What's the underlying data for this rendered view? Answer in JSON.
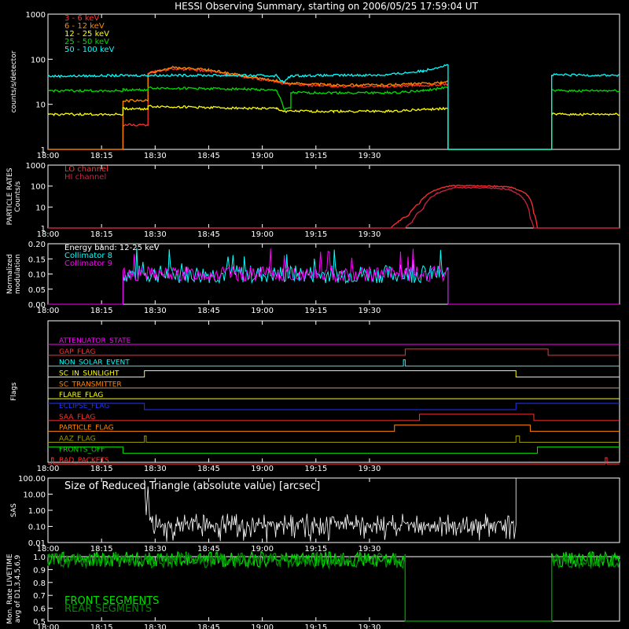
{
  "title": "HESSI Observing Summary, starting on 2006/05/25 17:59:04 UT",
  "time_ticks": [
    "18:00",
    "18:15",
    "18:30",
    "18:45",
    "19:00",
    "19:15",
    "19:30"
  ],
  "colors": {
    "axes": "#ffffff",
    "red": "#ff3030",
    "orange": "#ff8800",
    "yellow": "#ffff00",
    "green": "#00dd00",
    "cyan": "#00ffff",
    "magenta": "#ff00ff",
    "blue": "#2233ff",
    "olive": "#9a9a00",
    "white": "#ffffff"
  },
  "chart_data": [
    {
      "type": "line",
      "name": "count-rates",
      "ylabel": "counts/s/detector",
      "yscale": "log",
      "ylim": [
        1,
        1000
      ],
      "ytick_labels": [
        "1",
        "10",
        "100",
        "1000"
      ],
      "legend": [
        "3 - 6 keV",
        "6 - 12 keV",
        "12 - 25 keV",
        "25 - 50 keV",
        "50 - 100 keV"
      ],
      "series": [
        {
          "name": "3 - 6 keV",
          "color": "#ff3030",
          "points": [
            [
              0,
              1
            ],
            [
              21,
              1
            ],
            [
              21,
              3.5
            ],
            [
              28,
              3.5
            ],
            [
              28,
              50
            ],
            [
              35,
              62
            ],
            [
              45,
              55
            ],
            [
              55,
              40
            ],
            [
              64,
              32
            ],
            [
              66,
              28
            ],
            [
              80,
              25
            ],
            [
              95,
              25
            ],
            [
              110,
              27
            ],
            [
              112,
              28
            ]
          ]
        },
        {
          "name": "6 - 12 keV",
          "color": "#ff8800",
          "points": [
            [
              0,
              1
            ],
            [
              21,
              1
            ],
            [
              21,
              12
            ],
            [
              28,
              12
            ],
            [
              28,
              48
            ],
            [
              35,
              65
            ],
            [
              45,
              58
            ],
            [
              55,
              42
            ],
            [
              64,
              33
            ],
            [
              66,
              30
            ],
            [
              80,
              27
            ],
            [
              95,
              27
            ],
            [
              110,
              30
            ],
            [
              112,
              32
            ]
          ]
        },
        {
          "name": "12 - 25 keV",
          "color": "#ffff00",
          "points": [
            [
              0,
              6
            ],
            [
              21,
              6
            ],
            [
              21,
              8
            ],
            [
              28,
              8
            ],
            [
              28,
              9
            ],
            [
              64,
              8
            ],
            [
              66,
              7
            ],
            [
              80,
              7
            ],
            [
              95,
              7
            ],
            [
              110,
              8
            ],
            [
              112,
              8
            ],
            [
              112,
              1
            ],
            [
              141,
              1
            ],
            [
              141,
              6
            ],
            [
              160,
              6
            ]
          ]
        },
        {
          "name": "25 - 50 keV",
          "color": "#00dd00",
          "points": [
            [
              0,
              20
            ],
            [
              21,
              20
            ],
            [
              21,
              21
            ],
            [
              28,
              21
            ],
            [
              28,
              23
            ],
            [
              55,
              22
            ],
            [
              64,
              20
            ],
            [
              66,
              8
            ],
            [
              68,
              8
            ],
            [
              68,
              18
            ],
            [
              95,
              18
            ],
            [
              105,
              20
            ],
            [
              112,
              24
            ],
            [
              112,
              1
            ],
            [
              141,
              1
            ],
            [
              141,
              20
            ],
            [
              160,
              20
            ]
          ]
        },
        {
          "name": "50 - 100 keV",
          "color": "#00ffff",
          "points": [
            [
              0,
              42
            ],
            [
              28,
              44
            ],
            [
              50,
              44
            ],
            [
              64,
              43
            ],
            [
              66,
              30
            ],
            [
              68,
              43
            ],
            [
              95,
              45
            ],
            [
              105,
              55
            ],
            [
              112,
              75
            ],
            [
              112,
              1
            ],
            [
              141,
              1
            ],
            [
              141,
              45
            ],
            [
              160,
              44
            ]
          ]
        }
      ]
    },
    {
      "type": "line",
      "name": "particle-rates",
      "ylabel": "PARTICLE RATES\nCounts/s",
      "yscale": "log",
      "ylim": [
        1,
        1000
      ],
      "ytick_labels": [
        "1",
        "10",
        "100",
        "1000"
      ],
      "legend": [
        "LO channel",
        "HI channel"
      ],
      "series": [
        {
          "name": "LO channel",
          "color": "#ff3030",
          "points": [
            [
              0,
              1
            ],
            [
              96,
              1
            ],
            [
              98,
              2
            ],
            [
              101,
              4
            ],
            [
              104,
              15
            ],
            [
              108,
              60
            ],
            [
              113,
              105
            ],
            [
              125,
              100
            ],
            [
              130,
              85
            ],
            [
              134,
              40
            ],
            [
              136,
              5
            ],
            [
              137,
              1
            ],
            [
              160,
              1
            ]
          ]
        },
        {
          "name": "HI channel",
          "color": "#cc2244",
          "points": [
            [
              0,
              1
            ],
            [
              100,
              1
            ],
            [
              102,
              2
            ],
            [
              105,
              8
            ],
            [
              109,
              45
            ],
            [
              114,
              85
            ],
            [
              125,
              80
            ],
            [
              129,
              70
            ],
            [
              133,
              25
            ],
            [
              135,
              3
            ],
            [
              136,
              1
            ],
            [
              160,
              1
            ]
          ]
        }
      ]
    },
    {
      "type": "line",
      "name": "modulation",
      "ylabel": "Normalized\nmodulation",
      "yscale": "linear",
      "ylim": [
        0,
        0.2
      ],
      "ytick_labels": [
        "0.00",
        "0.05",
        "0.10",
        "0.15",
        "0.20"
      ],
      "legend": [
        "Energy band: 12-25 keV",
        "Collimator 8",
        "Collimator 9"
      ],
      "series": [
        {
          "name": "Collimator 8",
          "color": "#00ffff",
          "range": [
            21,
            112
          ],
          "level": 0.1,
          "noise": 0.03,
          "seed": 7
        },
        {
          "name": "Collimator 9",
          "color": "#ff00ff",
          "range": [
            21,
            112
          ],
          "level": 0.1,
          "noise": 0.025,
          "seed": 13
        }
      ]
    },
    {
      "type": "line",
      "name": "flags",
      "ylabel": "Flags",
      "flags": [
        {
          "name": "ATTENUATOR_STATE",
          "color": "#ff00ff",
          "steps": [
            [
              0,
              0
            ],
            [
              160,
              0
            ]
          ]
        },
        {
          "name": "GAP_FLAG",
          "color": "#ff3030",
          "steps": [
            [
              0,
              0
            ],
            [
              100,
              1
            ],
            [
              140,
              0
            ]
          ]
        },
        {
          "name": "NON_SOLAR_EVENT",
          "color": "#00ffff",
          "steps": [
            [
              0,
              0
            ],
            [
              99.5,
              1
            ],
            [
              100,
              0
            ]
          ]
        },
        {
          "name": "SC_IN_SUNLIGHT",
          "color": "#ffff00",
          "steps": [
            [
              0,
              0
            ],
            [
              27,
              1
            ],
            [
              131,
              0
            ]
          ]
        },
        {
          "name": "SC_TRANSMITTER",
          "color": "#ff8800",
          "steps": [
            [
              0,
              0
            ],
            [
              160,
              0
            ]
          ]
        },
        {
          "name": "FLARE_FLAG",
          "color": "#ffff00",
          "steps": [
            [
              0,
              0
            ],
            [
              160,
              0
            ]
          ]
        },
        {
          "name": "ECLIPSE_FLAG",
          "color": "#2233ff",
          "steps": [
            [
              0,
              1
            ],
            [
              27,
              0
            ],
            [
              131,
              1
            ]
          ]
        },
        {
          "name": "SAA_FLAG",
          "color": "#ff3030",
          "steps": [
            [
              0,
              0
            ],
            [
              104,
              1
            ],
            [
              136,
              0
            ]
          ]
        },
        {
          "name": "PARTICLE_FLAG",
          "color": "#ff8800",
          "steps": [
            [
              0,
              0
            ],
            [
              97,
              1
            ],
            [
              135,
              0
            ]
          ]
        },
        {
          "name": "AAZ_FLAG",
          "color": "#9a9a00",
          "steps": [
            [
              0,
              0
            ],
            [
              27,
              1
            ],
            [
              27.5,
              0
            ],
            [
              131,
              1
            ],
            [
              132,
              0
            ]
          ]
        },
        {
          "name": "FRONTS_OFF",
          "color": "#00dd00",
          "steps": [
            [
              0,
              1
            ],
            [
              21,
              0
            ],
            [
              137,
              1
            ]
          ]
        },
        {
          "name": "BAD_PACKETS",
          "color": "#ff3030",
          "steps": [
            [
              0,
              0
            ],
            [
              1,
              1
            ],
            [
              1.5,
              0
            ],
            [
              156,
              1
            ],
            [
              156.5,
              0
            ]
          ]
        }
      ]
    },
    {
      "type": "line",
      "name": "sas",
      "ylabel": "SAS",
      "yscale": "log",
      "ylim": [
        0.01,
        100
      ],
      "ytick_labels": [
        "0.01",
        "0.10",
        "1.00",
        "10.00",
        "100.00"
      ],
      "legend": [
        "Size of Reduced Triangle (absolute value) [arcsec]"
      ],
      "series": [
        {
          "name": "Size of Reduced Triangle (absolute value) [arcsec]",
          "color": "#ffffff",
          "range": [
            27,
            131
          ],
          "level": 0.2
        }
      ]
    },
    {
      "type": "line",
      "name": "livetime",
      "ylabel": "Mon. Rate LIVETIME\navg of D1,3,4,5,6,9",
      "yscale": "linear",
      "ylim": [
        0.5,
        1.0
      ],
      "ytick_labels": [
        "0.5",
        "0.6",
        "0.7",
        "0.8",
        "0.9",
        "1.0"
      ],
      "legend": [
        "FRONT SEGMENTS",
        "REAR SEGMENTS"
      ],
      "series": [
        {
          "name": "FRONT SEGMENTS",
          "color": "#00dd00",
          "points": [
            [
              0,
              0.98
            ],
            [
              100,
              0.98
            ],
            [
              100,
              0.5
            ],
            [
              141,
              0.5
            ],
            [
              141,
              0.98
            ],
            [
              160,
              0.98
            ]
          ]
        },
        {
          "name": "REAR SEGMENTS",
          "color": "#008800",
          "points": [
            [
              0,
              0.97
            ],
            [
              100,
              0.97
            ],
            [
              100,
              0.5
            ],
            [
              141,
              0.5
            ],
            [
              141,
              0.97
            ],
            [
              160,
              0.97
            ]
          ]
        }
      ]
    }
  ]
}
